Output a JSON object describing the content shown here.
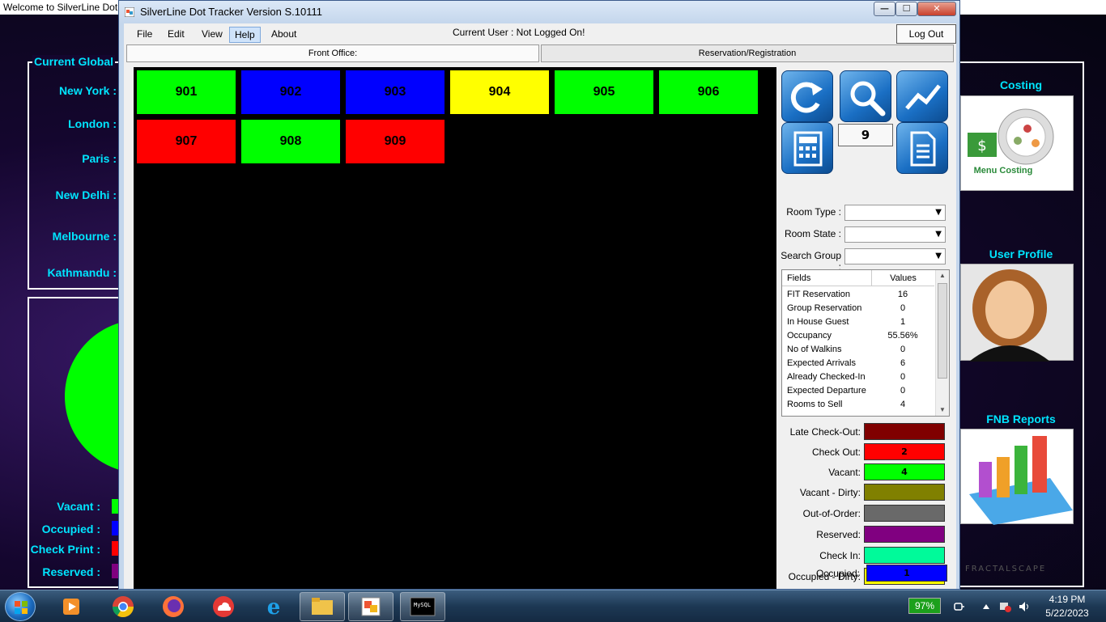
{
  "background_app": {
    "title": "Welcome to SilverLine Dot",
    "global_title": "Current Global",
    "cities": [
      "New York : ",
      "London : ",
      "Paris : ",
      "New Delhi : ",
      "Melbourne : ",
      "Kathmandu : "
    ],
    "legend": [
      {
        "label": "Vacant :",
        "color": "#00ff00"
      },
      {
        "label": "Occupied :",
        "color": "#0000ff"
      },
      {
        "label": "Check Print :",
        "color": "#ff0000"
      },
      {
        "label": "Reserved :",
        "color": "#800080"
      }
    ],
    "tiles": [
      {
        "title": "Costing",
        "caption": "Menu Costing"
      },
      {
        "title": "User Profile",
        "caption": ""
      },
      {
        "title": "FNB Reports",
        "caption": ""
      }
    ],
    "watermark": "FRACTALSCAPE"
  },
  "window": {
    "title": "SilverLine Dot Tracker Version  S.10111",
    "minimize": "—",
    "maximize": "☐",
    "close": "✕"
  },
  "menu": [
    "File",
    "Edit",
    "View",
    "Help",
    "About"
  ],
  "current_user": "Current User : Not Logged On!",
  "logout_label": "Log Out",
  "tabs": [
    "Front Office:",
    "Reservation/Registration"
  ],
  "rooms": [
    {
      "number": "901",
      "color": "#00ff00"
    },
    {
      "number": "902",
      "color": "#0000ff"
    },
    {
      "number": "903",
      "color": "#0000ff"
    },
    {
      "number": "904",
      "color": "#ffff00"
    },
    {
      "number": "905",
      "color": "#00ff00"
    },
    {
      "number": "906",
      "color": "#00ff00"
    },
    {
      "number": "907",
      "color": "#ff0000"
    },
    {
      "number": "908",
      "color": "#00ff00"
    },
    {
      "number": "909",
      "color": "#ff0000"
    }
  ],
  "toolbar": {
    "icons": [
      "refresh-icon",
      "search-icon",
      "chart-icon",
      "calculator-icon",
      "document-icon"
    ],
    "room_count": "9"
  },
  "filters": [
    {
      "label": "Room Type :",
      "value": ""
    },
    {
      "label": "Room State :",
      "value": ""
    },
    {
      "label": "Search Group :",
      "value": ""
    }
  ],
  "stats": {
    "header_field": "Fields",
    "header_value": "Values",
    "rows": [
      {
        "field": "FIT Reservation",
        "value": "16"
      },
      {
        "field": "Group Reservation",
        "value": "0"
      },
      {
        "field": "In House Guest",
        "value": "1"
      },
      {
        "field": "Occupancy",
        "value": "55.56%"
      },
      {
        "field": "No of Walkins",
        "value": "0"
      },
      {
        "field": "Expected Arrivals",
        "value": "6"
      },
      {
        "field": "Already Checked-In",
        "value": "0"
      },
      {
        "field": "Expected Departure",
        "value": "0"
      },
      {
        "field": "Rooms to Sell",
        "value": "4"
      }
    ]
  },
  "legend": [
    {
      "label": "Late Check-Out:",
      "color": "#800000",
      "count": ""
    },
    {
      "label": "Check Out:",
      "color": "#ff0000",
      "count": "2"
    },
    {
      "label": "Vacant:",
      "color": "#00ff00",
      "count": "4"
    },
    {
      "label": "Vacant - Dirty:",
      "color": "#808000",
      "count": ""
    },
    {
      "label": "Out-of-Order:",
      "color": "#696969",
      "count": ""
    },
    {
      "label": "Reserved:",
      "color": "#800080",
      "count": ""
    },
    {
      "label": "Check In:",
      "color": "#00fa9a",
      "count": ""
    },
    {
      "label": "Occupied - Dirty:",
      "color": "#ffff00",
      "count": "1"
    },
    {
      "label": "Occupied:",
      "color": "#0000ff",
      "count": "1"
    }
  ],
  "taskbar": {
    "apps": [
      "media-player-icon",
      "chrome-icon",
      "firefox-icon",
      "cloud-app-icon",
      "ie-icon",
      "file-explorer-icon",
      "silverline-app-icon",
      "mysql-icon"
    ],
    "mysql_label": "MySQL",
    "battery": "97%",
    "time": "4:19 PM",
    "date": "5/22/2023"
  }
}
